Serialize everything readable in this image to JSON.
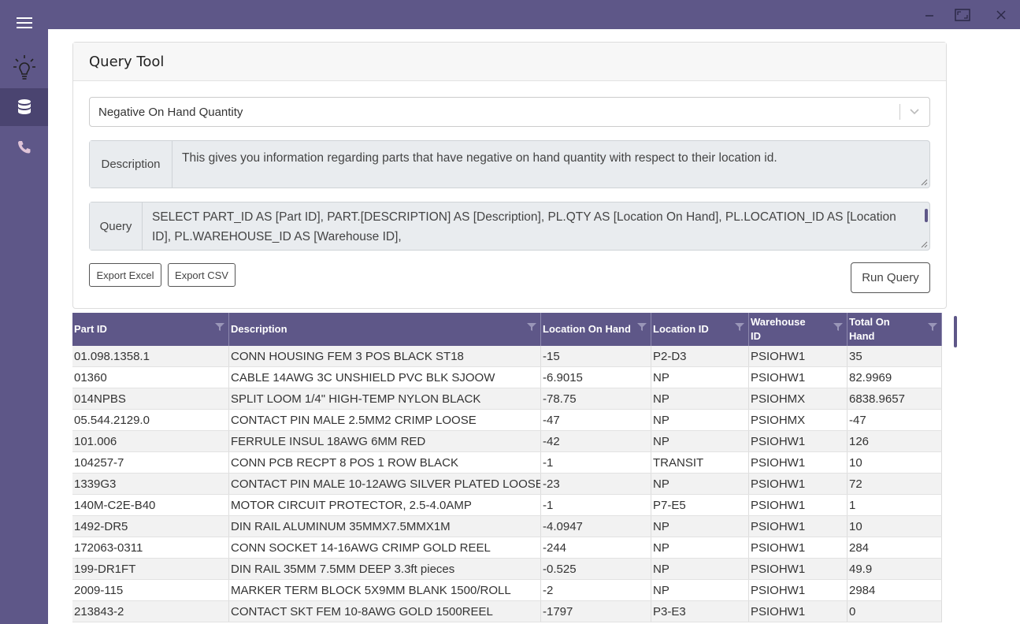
{
  "window": {
    "controls": [
      "minimize-icon",
      "maximize-icon",
      "close-icon"
    ]
  },
  "sidebar": {
    "menu_icon": "hamburger-icon",
    "items": [
      {
        "icon": "lightbulb-icon",
        "active": false
      },
      {
        "icon": "database-icon",
        "active": true
      },
      {
        "icon": "phone-icon",
        "active": false
      }
    ]
  },
  "colors": {
    "accent": "#5e5788",
    "active_nav": "#4a4470",
    "row_alt": "#f2f2f2"
  },
  "card": {
    "title": "Query Tool",
    "query_select": {
      "value": "Negative On Hand Quantity"
    },
    "description_label": "Description",
    "description_text": "This gives you information regarding parts that have negative on hand quantity with respect to their location id.",
    "query_label": "Query",
    "query_text": "SELECT PART_ID AS [Part ID], PART.[DESCRIPTION] AS [Description], PL.QTY AS [Location On Hand], PL.LOCATION_ID AS [Location ID], PL.WAREHOUSE_ID AS [Warehouse ID],",
    "export_excel": "Export Excel",
    "export_csv": "Export CSV",
    "run_query": "Run Query"
  },
  "table": {
    "columns": [
      "Part ID",
      "Description",
      "Location On Hand",
      "Location ID",
      "Warehouse ID",
      "Total On Hand"
    ],
    "rows": [
      [
        "01.098.1358.1",
        "CONN HOUSING FEM 3 POS BLACK ST18",
        "-15",
        "P2-D3",
        "PSIOHW1",
        "35"
      ],
      [
        "01360",
        "CABLE 14AWG 3C UNSHIELD PVC BLK SJOOW",
        "-6.9015",
        "NP",
        "PSIOHW1",
        "82.9969"
      ],
      [
        "014NPBS",
        "SPLIT LOOM 1/4\" HIGH-TEMP NYLON BLACK",
        "-78.75",
        "NP",
        "PSIOHMX",
        "6838.9657"
      ],
      [
        "05.544.2129.0",
        "CONTACT PIN MALE 2.5MM2 CRIMP LOOSE",
        "-47",
        "NP",
        "PSIOHMX",
        "-47"
      ],
      [
        "101.006",
        "FERRULE INSUL 18AWG 6MM RED",
        "-42",
        "NP",
        "PSIOHW1",
        "126"
      ],
      [
        "104257-7",
        "CONN PCB RECPT 8 POS 1 ROW BLACK",
        "-1",
        "TRANSIT",
        "PSIOHW1",
        "10"
      ],
      [
        "1339G3",
        "CONTACT PIN MALE 10-12AWG SILVER PLATED LOOSE",
        "-23",
        "NP",
        "PSIOHW1",
        "72"
      ],
      [
        "140M-C2E-B40",
        "MOTOR CIRCUIT PROTECTOR, 2.5-4.0AMP",
        "-1",
        "P7-E5",
        "PSIOHW1",
        "1"
      ],
      [
        "1492-DR5",
        "DIN RAIL ALUMINUM 35MMX7.5MMX1M",
        "-4.0947",
        "NP",
        "PSIOHW1",
        "10"
      ],
      [
        "172063-0311",
        "CONN SOCKET 14-16AWG CRIMP GOLD REEL",
        "-244",
        "NP",
        "PSIOHW1",
        "284"
      ],
      [
        "199-DR1FT",
        "DIN RAIL 35MM 7.5MM DEEP 3.3ft pieces",
        "-0.525",
        "NP",
        "PSIOHW1",
        "49.9"
      ],
      [
        "2009-115",
        "MARKER TERM BLOCK 5X9MM BLANK 1500/ROLL",
        "-2",
        "NP",
        "PSIOHW1",
        "2984"
      ],
      [
        "213843-2",
        "CONTACT SKT FEM 10-8AWG GOLD 1500REEL",
        "-1797",
        "P3-E3",
        "PSIOHW1",
        "0"
      ]
    ]
  }
}
